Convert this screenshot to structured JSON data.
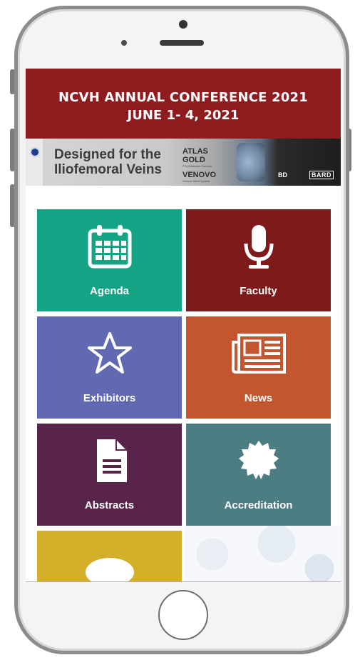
{
  "header": {
    "line1": "NCVH ANNUAL CONFERENCE 2021",
    "line2": "JUNE 1- 4, 2021",
    "color": "#8e1c1f"
  },
  "banner": {
    "tagline": "Designed for the Iliofemoral Veins",
    "products": [
      {
        "name": "ATLAS GOLD",
        "sub": "PTA Dilatation Catheter"
      },
      {
        "name": "VENOVO",
        "sub": "Venous Stent System"
      }
    ],
    "logo_bd": "BD",
    "logo_bard": "BARD"
  },
  "tiles": [
    {
      "label": "Agenda",
      "icon": "calendar-icon",
      "color": "#14a485"
    },
    {
      "label": "Faculty",
      "icon": "microphone-icon",
      "color": "#7f1a1a"
    },
    {
      "label": "Exhibitors",
      "icon": "star-icon",
      "color": "#6069b1"
    },
    {
      "label": "News",
      "icon": "newspaper-icon",
      "color": "#c3552f"
    },
    {
      "label": "Abstracts",
      "icon": "document-icon",
      "color": "#59244a"
    },
    {
      "label": "Accreditation",
      "icon": "badge-icon",
      "color": "#4c7d83"
    },
    {
      "label": "",
      "icon": "partial-tile-icon",
      "color": "#d4b02a"
    }
  ]
}
